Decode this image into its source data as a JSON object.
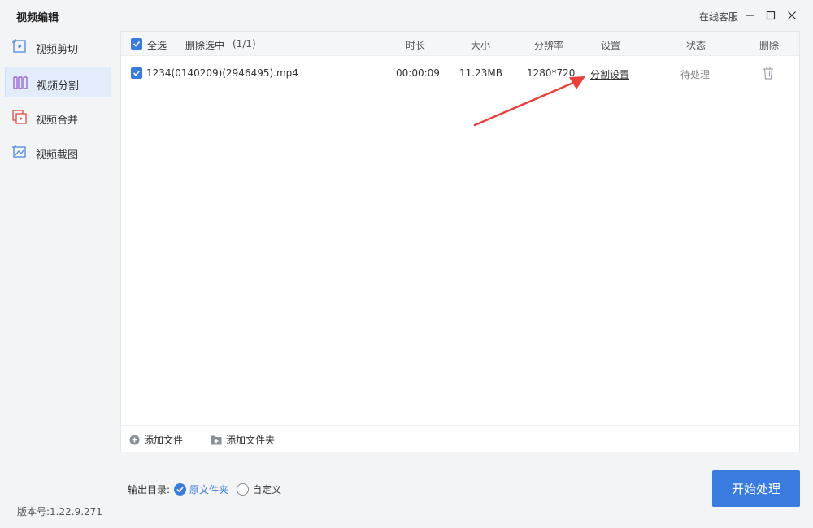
{
  "window": {
    "title": "视频编辑",
    "support_label": "在线客服"
  },
  "sidebar": {
    "items": [
      {
        "label": "视频剪切",
        "icon": "video-cut-icon"
      },
      {
        "label": "视频分割",
        "icon": "video-split-icon",
        "active": true
      },
      {
        "label": "视频合并",
        "icon": "video-merge-icon"
      },
      {
        "label": "视频截图",
        "icon": "video-screenshot-icon"
      }
    ]
  },
  "version_label": "版本号:1.22.9.271",
  "table": {
    "select_all": "全选",
    "delete_selected": "删除选中",
    "count": "(1/1)",
    "headers": {
      "duration": "时长",
      "size": "大小",
      "resolution": "分辨率",
      "settings": "设置",
      "status": "状态",
      "delete": "删除"
    },
    "rows": [
      {
        "filename": "1234(0140209)(2946495).mp4",
        "duration": "00:00:09",
        "size": "11.23MB",
        "resolution": "1280*720",
        "settings_link": "分割设置",
        "status": "待处理"
      }
    ]
  },
  "footer": {
    "add_file": "添加文件",
    "add_folder": "添加文件夹"
  },
  "output": {
    "label": "输出目录:",
    "option_original": "原文件夹",
    "option_custom": "自定义",
    "selected": "原文件夹"
  },
  "start_button": "开始处理",
  "colors": {
    "accent": "#3a7bdf",
    "annotation_arrow": "#e8403a"
  }
}
